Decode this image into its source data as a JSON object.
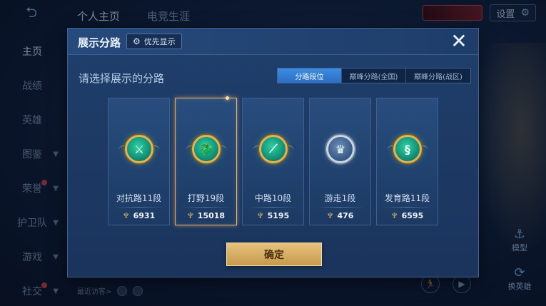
{
  "background": {
    "top_tabs": [
      {
        "label": "个人主页",
        "active": true
      },
      {
        "label": "电竞生涯",
        "active": false
      }
    ],
    "settings_label": "设置",
    "sidebar": [
      {
        "label": "主页",
        "active": true
      },
      {
        "label": "战绩"
      },
      {
        "label": "英雄"
      },
      {
        "label": "图鉴"
      },
      {
        "label": "荣誉"
      },
      {
        "label": "护卫队"
      },
      {
        "label": "游戏"
      },
      {
        "label": "社交"
      }
    ],
    "visitors_label": "最近访客>",
    "right_buttons": [
      {
        "label": "模型"
      },
      {
        "label": "换英雄"
      }
    ]
  },
  "modal": {
    "title": "展示分路",
    "priority_button": "优先显示",
    "section_label": "请选择展示的分路",
    "seg_tabs": [
      {
        "label": "分路段位",
        "active": true
      },
      {
        "label": "巅峰分路(全国)",
        "active": false
      },
      {
        "label": "巅峰分路(战区)",
        "active": false
      }
    ],
    "cards": [
      {
        "name": "对抗路11段",
        "score": "6931",
        "selected": false,
        "icon": "crossed-swords-icon",
        "emblem": "gold"
      },
      {
        "name": "打野19段",
        "score": "15018",
        "selected": true,
        "icon": "dragon-icon",
        "emblem": "gold"
      },
      {
        "name": "中路10段",
        "score": "5195",
        "selected": false,
        "icon": "slash-blade-icon",
        "emblem": "gold"
      },
      {
        "name": "游走1段",
        "score": "476",
        "selected": false,
        "icon": "winged-shield-icon",
        "emblem": "silver"
      },
      {
        "name": "发育路11段",
        "score": "6595",
        "selected": false,
        "icon": "arrow-s-icon",
        "emblem": "gold"
      }
    ],
    "confirm_label": "确定"
  },
  "colors": {
    "accent_gold": "#e6c27c",
    "selected_border": "#e9b26a",
    "active_tab": "#3d8de0"
  }
}
